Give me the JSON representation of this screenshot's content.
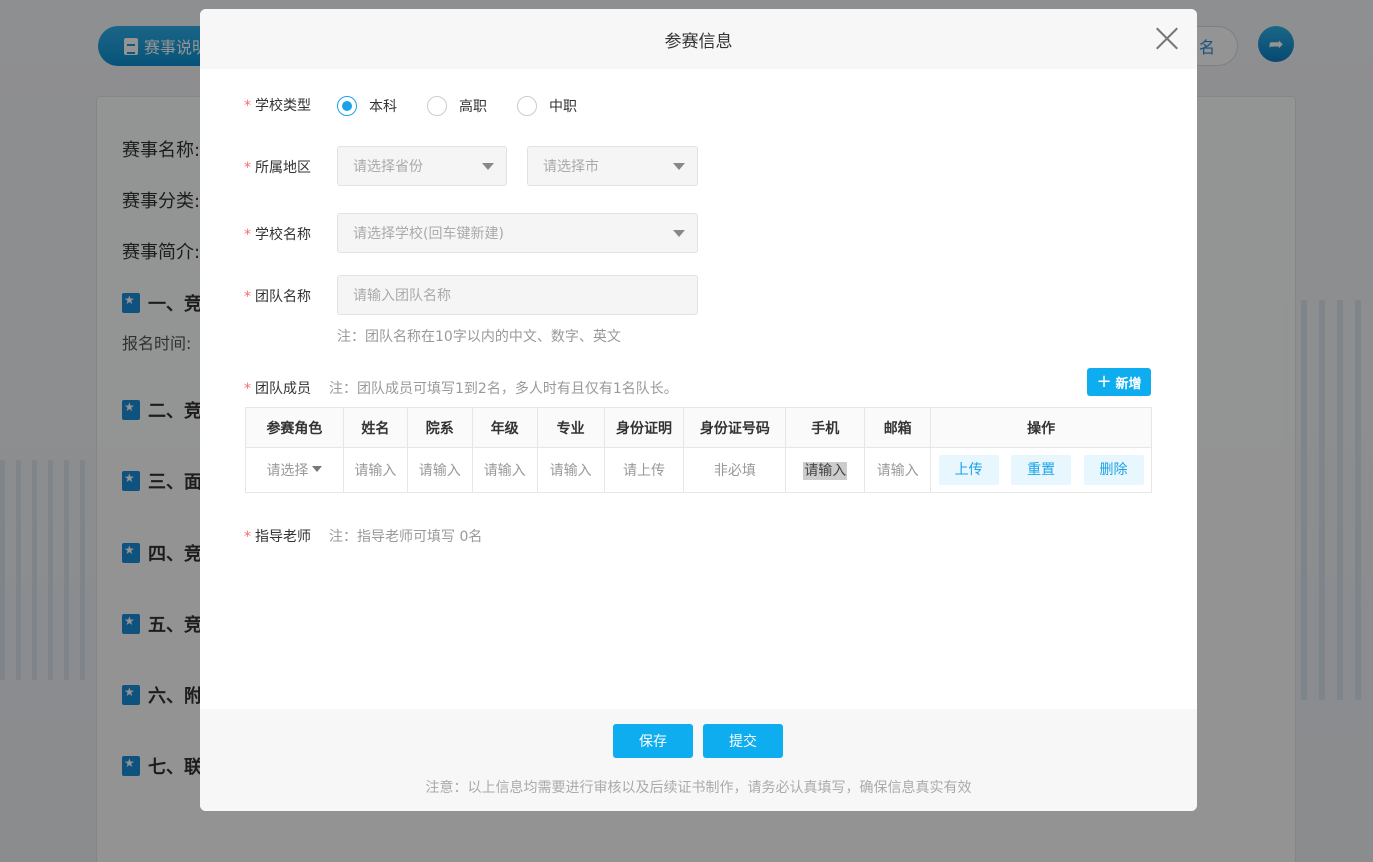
{
  "background": {
    "rules_button": "赛事说明",
    "right_button": "名",
    "fields": [
      "赛事名称:",
      "赛事分类:",
      "赛事简介:"
    ],
    "sections": [
      "一、竞",
      "二、竞",
      "三、面",
      "四、竞",
      "五、竞",
      "六、附",
      "七、联"
    ],
    "sub_text": "报名时间:"
  },
  "modal": {
    "title": "参赛信息",
    "school_type": {
      "label": "学校类型",
      "options": [
        "本科",
        "高职",
        "中职"
      ],
      "selected": "本科"
    },
    "region": {
      "label": "所属地区",
      "province_placeholder": "请选择省份",
      "city_placeholder": "请选择市"
    },
    "school_name": {
      "label": "学校名称",
      "placeholder": "请选择学校(回车键新建)"
    },
    "team_name": {
      "label": "团队名称",
      "placeholder": "请输入团队名称",
      "note": "注：团队名称在10字以内的中文、数字、英文"
    },
    "team_members": {
      "label": "团队成员",
      "note": "注：团队成员可填写1到2名，多人时有且仅有1名队长。",
      "add_button": "新增",
      "columns": [
        "参赛角色",
        "姓名",
        "院系",
        "年级",
        "专业",
        "身份证明",
        "身份证号码",
        "手机",
        "邮箱",
        "操作"
      ],
      "row": {
        "role": "请选择",
        "name": "请输入",
        "department": "请输入",
        "grade": "请输入",
        "major": "请输入",
        "id_proof": "请上传",
        "id_number": "非必填",
        "phone": "请输入",
        "email": "请输入",
        "actions": [
          "上传",
          "重置",
          "删除"
        ]
      }
    },
    "advisor": {
      "label": "指导老师",
      "note": "注：指导老师可填写 0名"
    },
    "footer": {
      "save": "保存",
      "submit": "提交",
      "note": "注意：以上信息均需要进行审核以及后续证书制作，请务必认真填写，确保信息真实有效"
    }
  },
  "colors": {
    "accent": "#0dadf0",
    "required": "#f56c6c"
  }
}
